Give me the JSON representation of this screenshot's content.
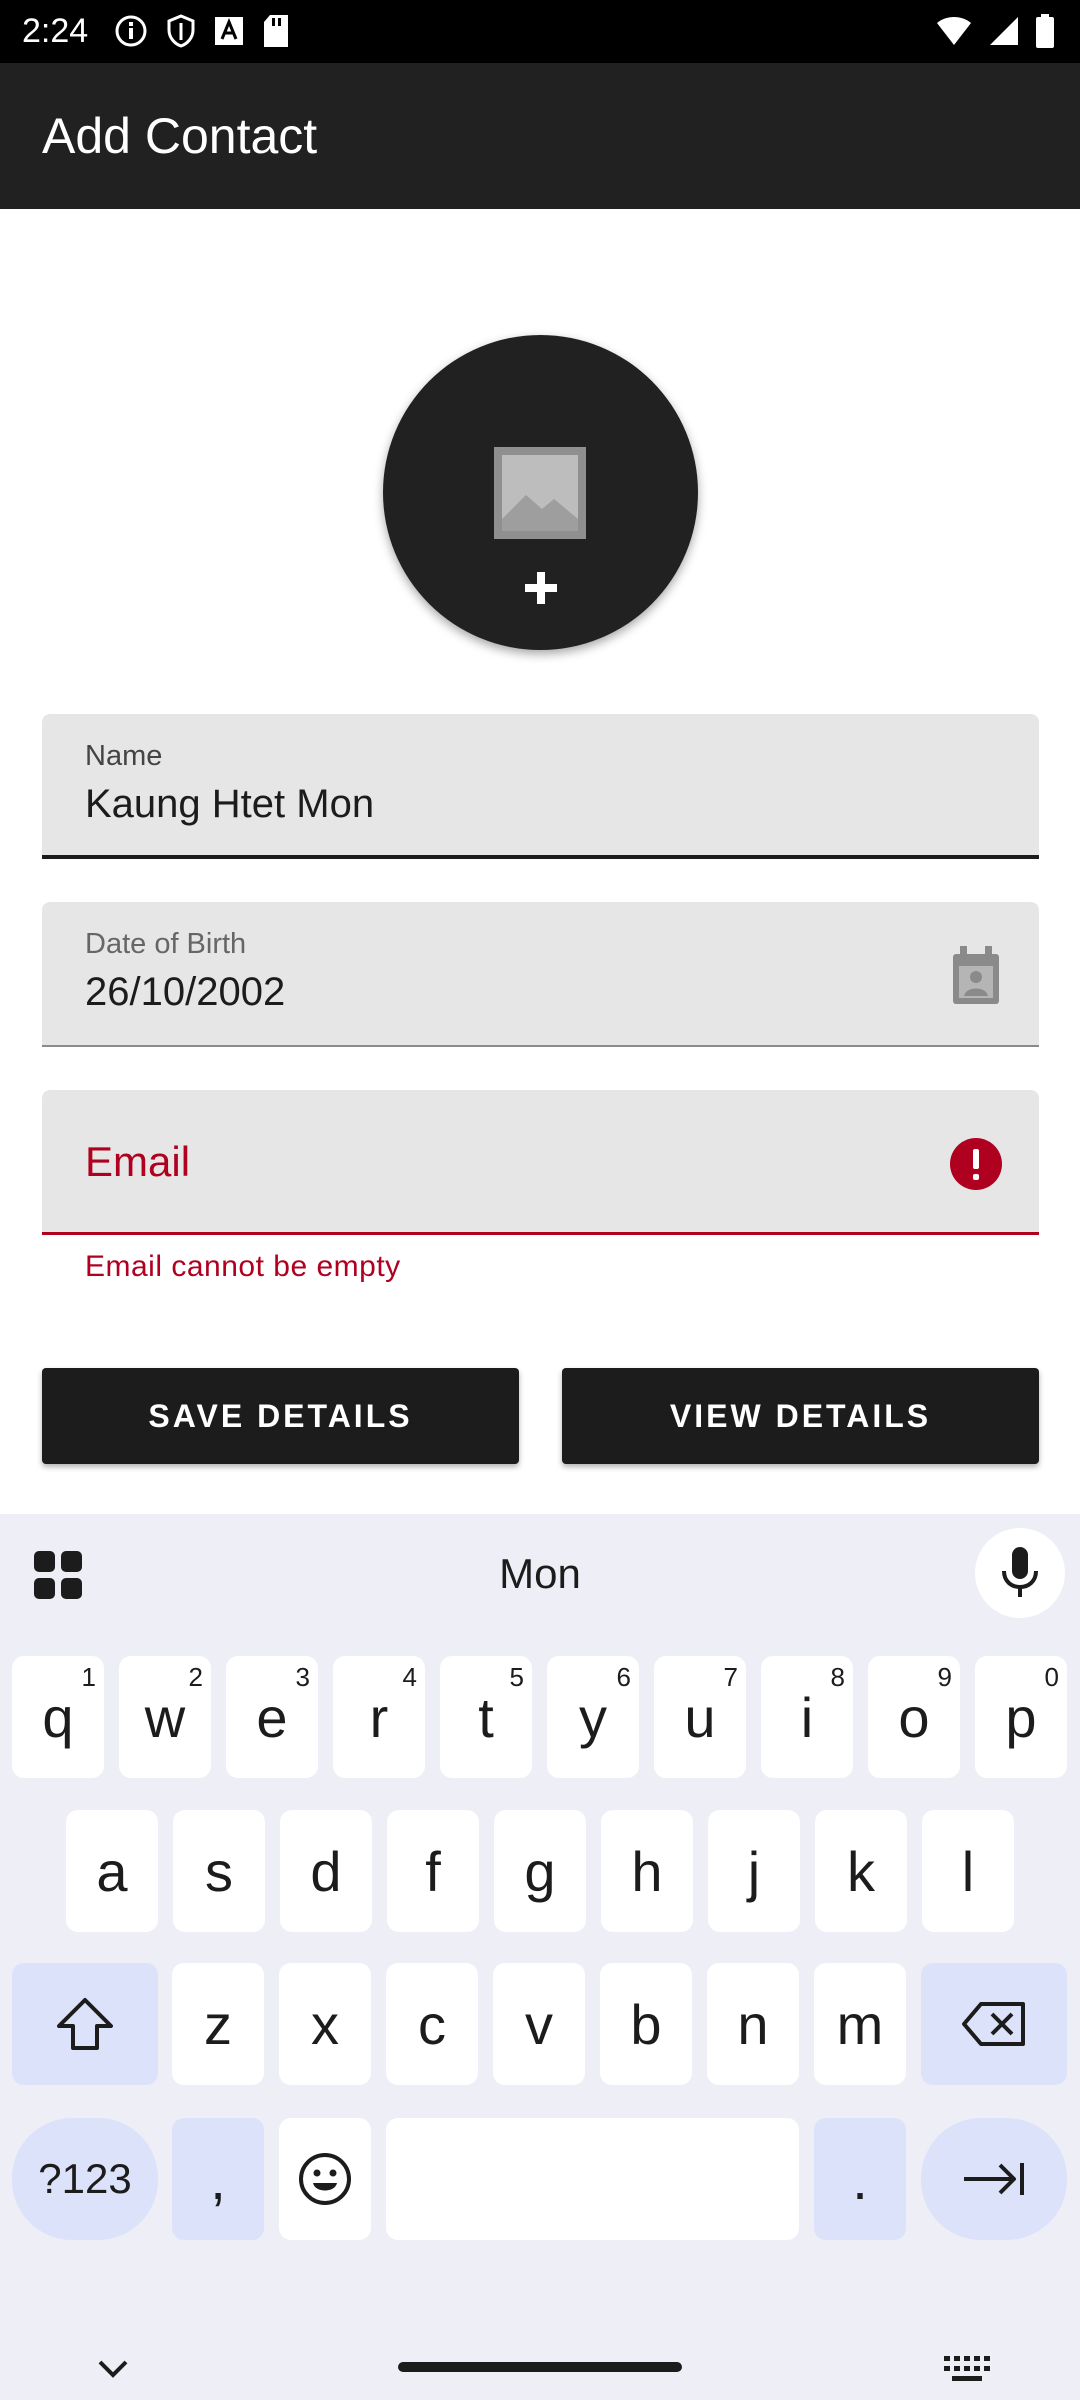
{
  "status_bar": {
    "time": "2:24",
    "left_icons": [
      "info-icon",
      "shield-icon",
      "font-icon",
      "sd-card-icon"
    ],
    "right_icons": [
      "wifi-icon",
      "signal-icon",
      "battery-icon"
    ]
  },
  "app_bar": {
    "title": "Add Contact"
  },
  "avatar": {
    "icons": [
      "image-placeholder-icon",
      "plus-icon"
    ]
  },
  "form": {
    "name": {
      "label": "Name",
      "value": "Kaung Htet Mon"
    },
    "dob": {
      "label": "Date of Birth",
      "value": "26/10/2002"
    },
    "email": {
      "label": "Email",
      "error": "Email cannot be empty"
    }
  },
  "buttons": {
    "save": "SAVE DETAILS",
    "view": "VIEW DETAILS"
  },
  "keyboard": {
    "suggestion": "Mon",
    "row1": [
      {
        "k": "q",
        "h": "1"
      },
      {
        "k": "w",
        "h": "2"
      },
      {
        "k": "e",
        "h": "3"
      },
      {
        "k": "r",
        "h": "4"
      },
      {
        "k": "t",
        "h": "5"
      },
      {
        "k": "y",
        "h": "6"
      },
      {
        "k": "u",
        "h": "7"
      },
      {
        "k": "i",
        "h": "8"
      },
      {
        "k": "o",
        "h": "9"
      },
      {
        "k": "p",
        "h": "0"
      }
    ],
    "row2": [
      "a",
      "s",
      "d",
      "f",
      "g",
      "h",
      "j",
      "k",
      "l"
    ],
    "row3": [
      "z",
      "x",
      "c",
      "v",
      "b",
      "n",
      "m"
    ],
    "symbols_key": "?123",
    "comma_key": ",",
    "period_key": ".",
    "colors": {
      "background": "#eeeef6",
      "modifier_key": "#dce2f9",
      "key": "#ffffff"
    }
  },
  "colors": {
    "app_bar": "#212121",
    "error": "#b00020",
    "field_bg": "#e6e6e6",
    "button": "#1c1c1c"
  }
}
